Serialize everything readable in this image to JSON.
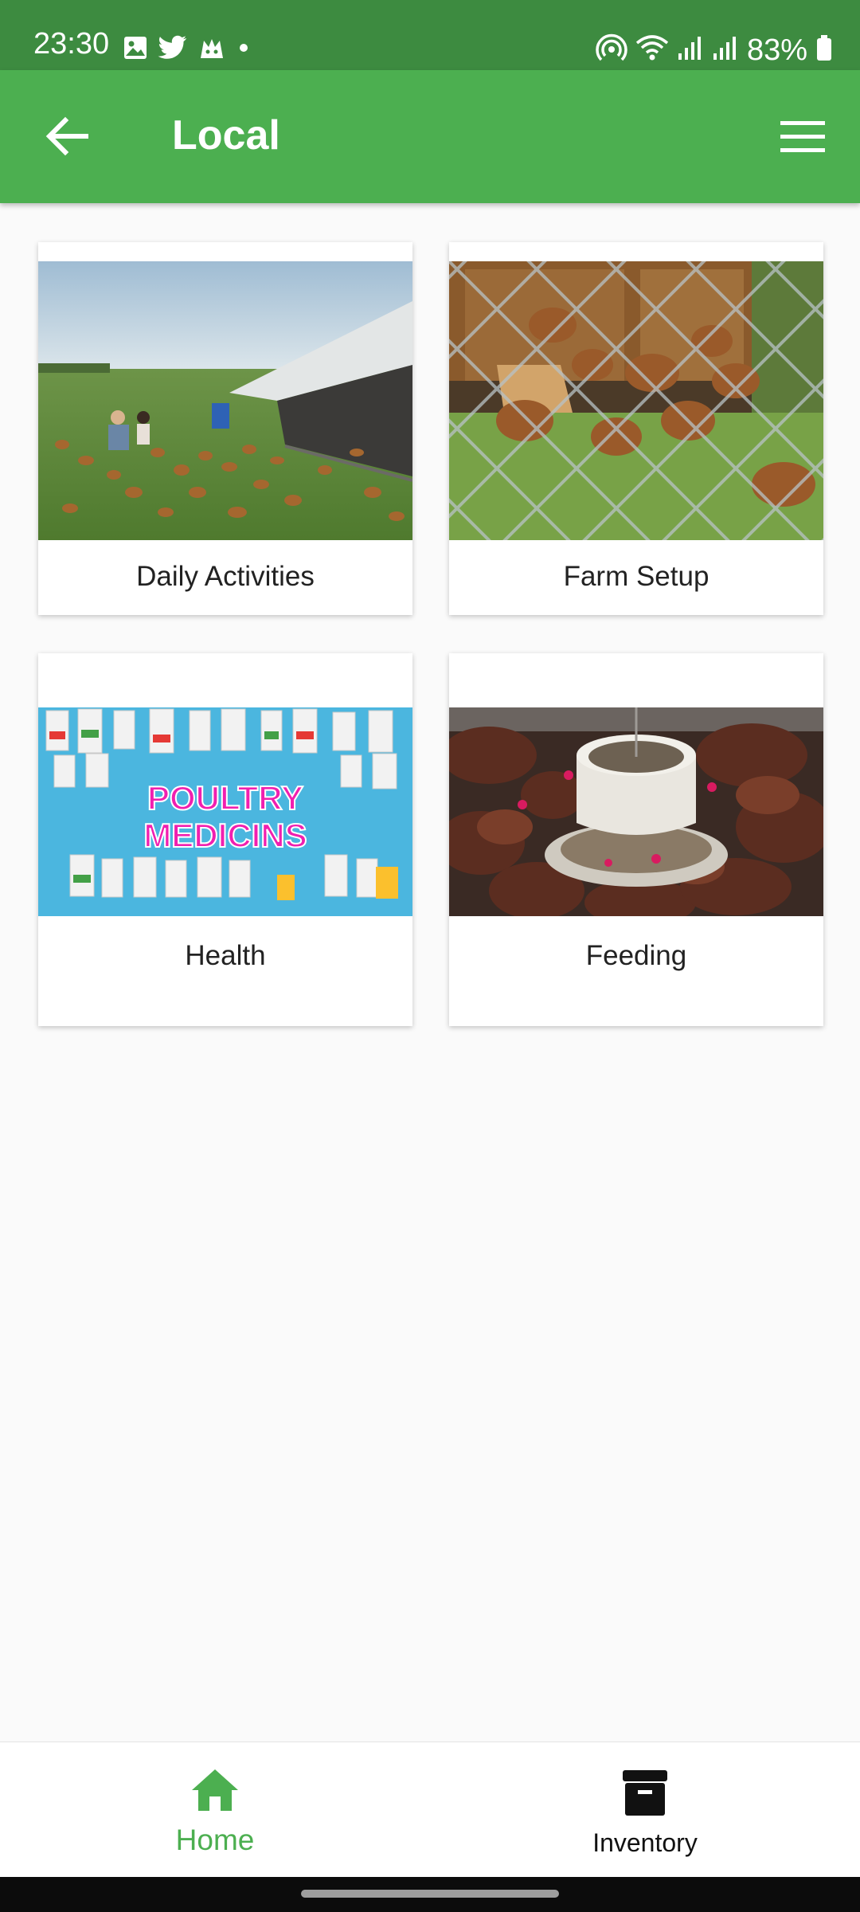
{
  "status_bar": {
    "time": "23:30",
    "battery": "83%",
    "left_icons": [
      "gallery-icon",
      "twitter-icon",
      "game-icon",
      "dot-icon"
    ],
    "right_icons": [
      "hotspot-icon",
      "wifi-icon",
      "signal-icon",
      "signal-icon",
      "battery-icon"
    ]
  },
  "app_bar": {
    "title": "Local",
    "back_icon": "arrow-left-icon",
    "menu_icon": "hamburger-menu-icon"
  },
  "cards": [
    {
      "label": "Daily Activities",
      "image": "chickens-free-range-photo"
    },
    {
      "label": "Farm Setup",
      "image": "chicken-coop-fence-photo"
    },
    {
      "label": "Health",
      "image": "poultry-medicines-photo",
      "image_text": [
        "POULTRY",
        "MEDICINS"
      ]
    },
    {
      "label": "Feeding",
      "image": "chickens-feeder-photo"
    }
  ],
  "bottom_nav": {
    "items": [
      {
        "label": "Home",
        "icon": "home-icon",
        "active": true
      },
      {
        "label": "Inventory",
        "icon": "archive-box-icon",
        "active": false
      }
    ]
  },
  "colors": {
    "status_bar": "#3d8b40",
    "primary": "#4caf50",
    "background": "#fafafa",
    "active_nav": "#4caf50"
  }
}
